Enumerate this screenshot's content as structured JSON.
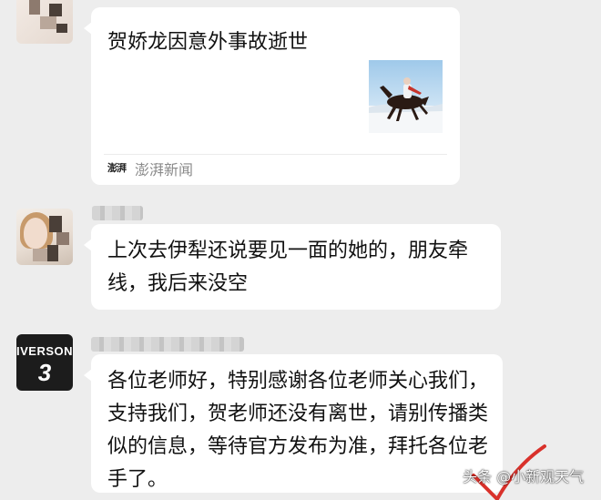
{
  "messages": [
    {
      "type": "link-card",
      "title": "贺娇龙因意外事故逝世",
      "thumbnail": "horse-rider-snow-thumbnail",
      "source": {
        "logo_text": "澎湃",
        "name": "澎湃新闻"
      }
    },
    {
      "type": "text",
      "text": "上次去伊犁还说要见一面的她的，朋友牵线，我后来没空"
    },
    {
      "type": "text",
      "text": "各位老师好，特别感谢各位老师关心我们，支持我们，贺老师还没有离世，请别传播类似的信息，等待官方发布为准，拜托各位老手了。"
    }
  ],
  "avatars": {
    "third": {
      "jersey_name": "IVERSON",
      "jersey_number": "3"
    }
  },
  "watermark": "头条 @小新观天气",
  "colors": {
    "chat_background": "#ededed",
    "bubble": "#ffffff",
    "text": "#111111",
    "source_text": "#8a8a8a",
    "check_mark": "#d9312b"
  },
  "icons": [
    "check-mark-icon",
    "pengpai-logo-icon"
  ]
}
